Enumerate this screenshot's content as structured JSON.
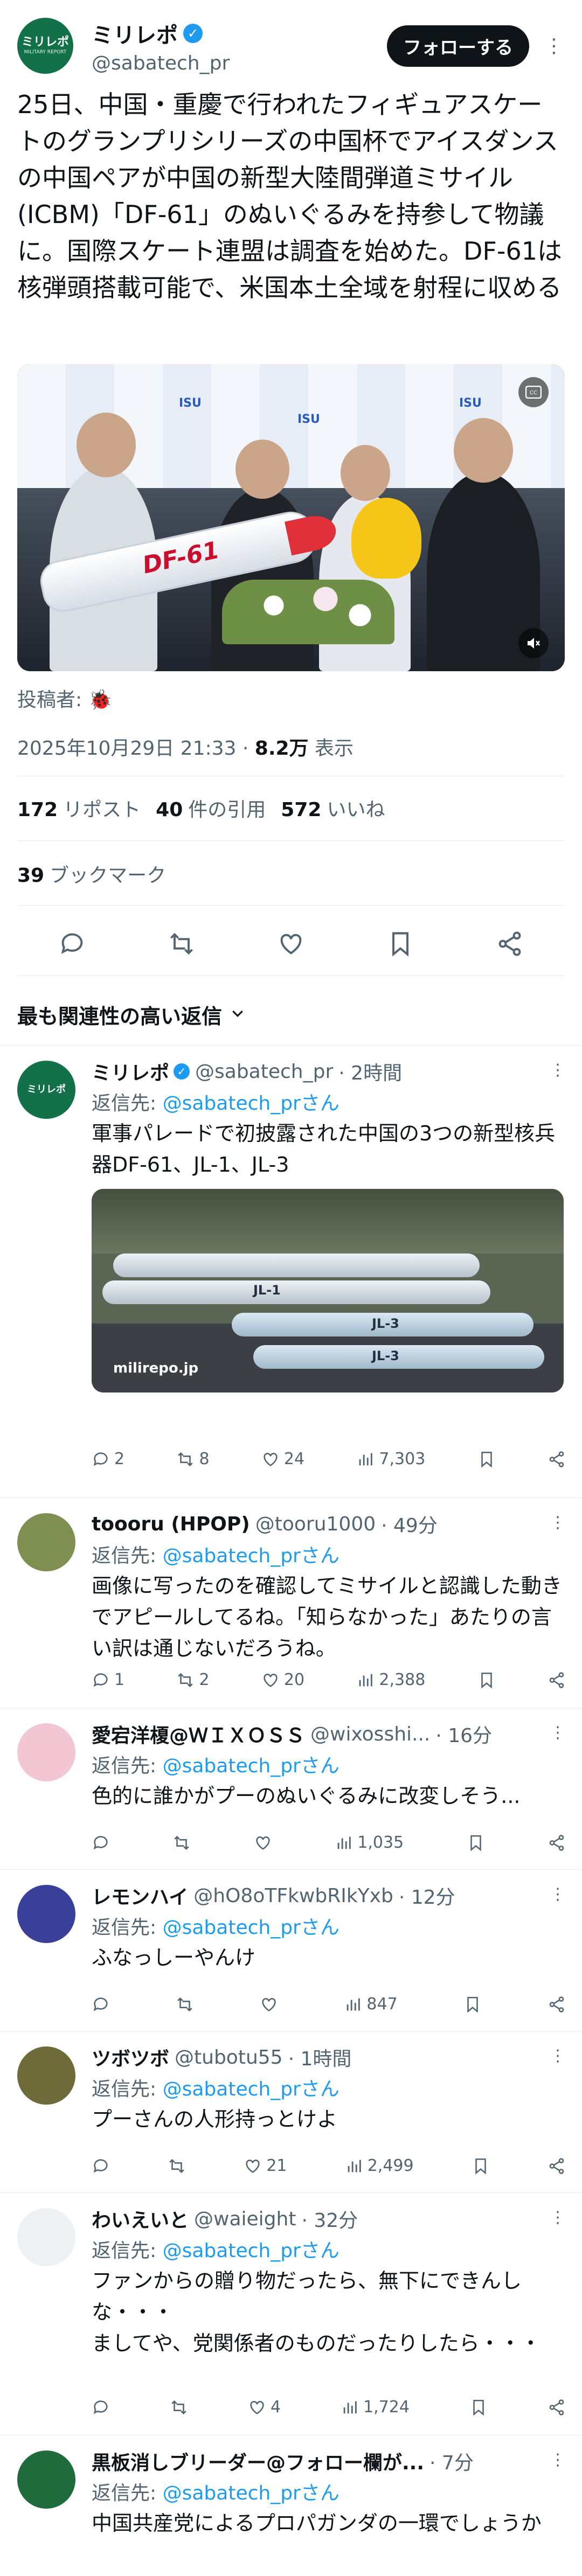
{
  "post": {
    "author_name": "ミリレポ",
    "author_handle": "@sabatech_pr",
    "follow_label": "フォローする",
    "avatar_line1": "ミリレポ",
    "avatar_line2": "MILITARY REPORT",
    "text": "25日、中国・重慶で行われたフィギュアスケートのグランプリシリーズの中国杯でアイスダンスの中国ペアが中国の新型大陸間弾道ミサイル(ICBM)「DF-61」のぬいぐるみを持参して物議に。国際スケート連盟は調査を始めた。DF-61は核弾頭搭載可能で、米国本土全域を射程に収める",
    "media_missile_label": "DF-61",
    "backdrop_label": "ISU",
    "poster_label": "投稿者:",
    "poster_icon": "ladybug-icon",
    "timestamp": "2025年10月29日 21:33",
    "view_count": "8.2万",
    "view_label": "表示",
    "retweet_count": "172",
    "retweet_label": "リポスト",
    "quote_count": "40",
    "quote_label": "件の引用",
    "like_count": "572",
    "like_label": "いいね",
    "bookmark_count": "39",
    "bookmark_label": "ブックマーク"
  },
  "sort_label": "最も関連性の高い返信",
  "replies": [
    {
      "name": "ミリレポ",
      "handle": "@sabatech_pr",
      "time": "· 2時間",
      "verified": true,
      "reply_to_prefix": "返信先:",
      "reply_to": "@sabatech_prさん",
      "text": "軍事パレードで初披露された中国の3つの新型核兵器DF-61、JL-1、JL-3",
      "media_watermark": "milirepo.jp",
      "media_labels": [
        "JL-1",
        "JL-3",
        "JL-3"
      ],
      "stats": {
        "reply": "2",
        "retweet": "8",
        "like": "24",
        "views": "7,303"
      }
    },
    {
      "name": "toooru (HPOP)",
      "handle": "@tooru1000",
      "time": "· 49分",
      "reply_to_prefix": "返信先:",
      "reply_to": "@sabatech_prさん",
      "text": "画像に写ったのを確認してミサイルと認識した動きでアピールしてるね。「知らなかった」あたりの言い訳は通じないだろうね。",
      "stats": {
        "reply": "1",
        "retweet": "2",
        "like": "20",
        "views": "2,388"
      }
    },
    {
      "name": "愛宕洋榎@ＷＩＸＯＳＳ",
      "handle": "@wixosshi...",
      "time": "· 16分",
      "reply_to_prefix": "返信先:",
      "reply_to": "@sabatech_prさん",
      "text": "色的に誰かがプーのぬいぐるみに改変しそう...",
      "stats": {
        "reply": "",
        "retweet": "",
        "like": "",
        "views": "1,035"
      }
    },
    {
      "name": "レモンハイ",
      "handle": "@hO8oTFkwbRIkYxb",
      "time": "· 12分",
      "reply_to_prefix": "返信先:",
      "reply_to": "@sabatech_prさん",
      "text": "ふなっしーやんけ",
      "stats": {
        "reply": "",
        "retweet": "",
        "like": "",
        "views": "847"
      }
    },
    {
      "name": "ツボツボ",
      "handle": "@tubotu55",
      "time": "· 1時間",
      "reply_to_prefix": "返信先:",
      "reply_to": "@sabatech_prさん",
      "text": "プーさんの人形持っとけよ",
      "stats": {
        "reply": "",
        "retweet": "",
        "like": "21",
        "views": "2,499"
      }
    },
    {
      "name": "わいえいと",
      "handle": "@waieight",
      "time": "· 32分",
      "reply_to_prefix": "返信先:",
      "reply_to": "@sabatech_prさん",
      "text": "ファンからの贈り物だったら、無下にできんしな・・・\nましてや、党関係者のものだったりしたら・・・",
      "stats": {
        "reply": "",
        "retweet": "",
        "like": "4",
        "views": "1,724"
      }
    },
    {
      "name": "黒板消しブリーダー@フォロー欄が...",
      "handle": "",
      "time": "· 7分",
      "reply_to_prefix": "返信先:",
      "reply_to": "@sabatech_prさん",
      "text": "中国共産党によるプロパガンダの一環でしょうか",
      "stats": {
        "reply": "",
        "retweet": "",
        "like": "",
        "views": ""
      }
    }
  ],
  "colors": {
    "accent": "#1d9bf0",
    "text": "#0f1419",
    "muted": "#536471",
    "divider": "#e7e9ea",
    "brand_green": "#13714a"
  }
}
